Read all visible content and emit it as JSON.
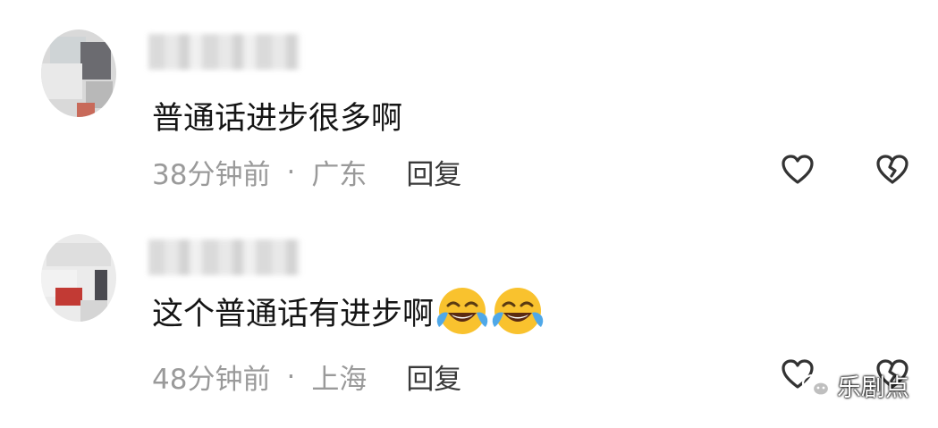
{
  "comments": [
    {
      "text": "普通话进步很多啊",
      "time": "38分钟前",
      "separator": "·",
      "location": "广东",
      "reply_label": "回复"
    },
    {
      "text": "这个普通话有进步啊",
      "emoji": [
        "laughing-crying-emoji",
        "laughing-crying-emoji"
      ],
      "time": "48分钟前",
      "separator": "·",
      "location": "上海",
      "reply_label": "回复"
    }
  ],
  "watermark": {
    "text": "乐剧点",
    "icon": "wechat-icon"
  },
  "colors": {
    "text": "#151515",
    "meta": "#9a9a9a",
    "reply": "#3a3a3a",
    "icon": "#333333"
  }
}
